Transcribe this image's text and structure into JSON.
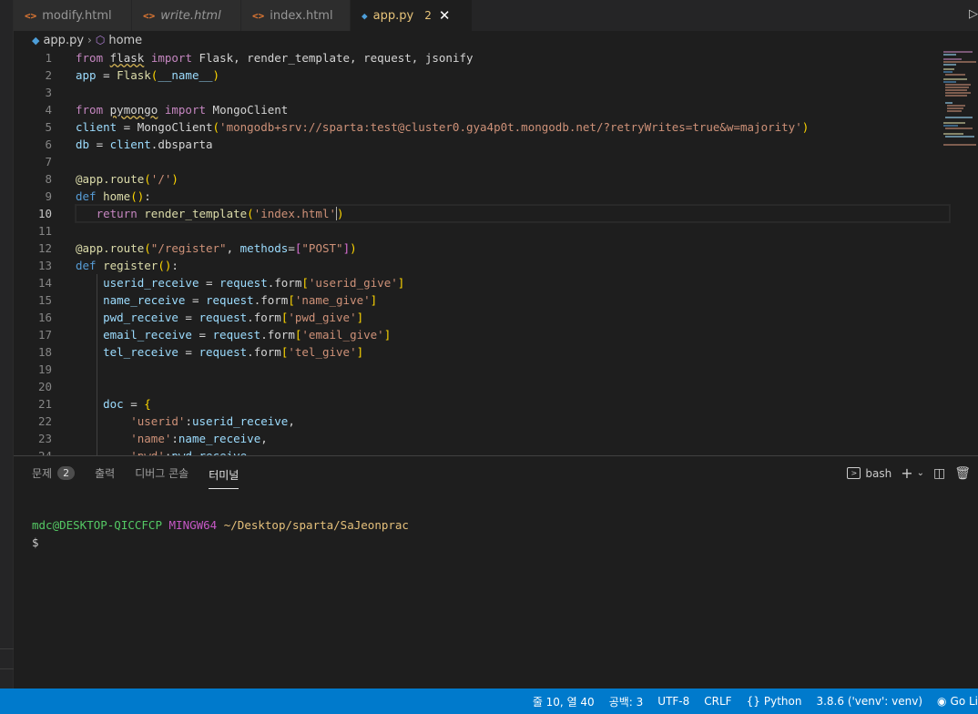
{
  "tabs": [
    {
      "name": "modify.html",
      "icon": "<>",
      "type": "html",
      "italic": false
    },
    {
      "name": "write.html",
      "icon": "<>",
      "type": "html",
      "italic": true
    },
    {
      "name": "index.html",
      "icon": "<>",
      "type": "html",
      "italic": false
    },
    {
      "name": "app.py",
      "icon": "python-icon",
      "type": "py",
      "active": true,
      "problems": "2",
      "close": "✕"
    }
  ],
  "breadcrumb": {
    "file": "app.py",
    "symbol": "home"
  },
  "editor": {
    "current_line": 10,
    "line_numbers": [
      "1",
      "2",
      "3",
      "4",
      "5",
      "6",
      "7",
      "8",
      "9",
      "10",
      "11",
      "12",
      "13",
      "14",
      "15",
      "16",
      "17",
      "18",
      "19",
      "20",
      "21",
      "22",
      "23",
      "24"
    ]
  },
  "panel": {
    "tabs": [
      {
        "label": "문제",
        "badge": "2"
      },
      {
        "label": "출력"
      },
      {
        "label": "디버그 콘솔"
      },
      {
        "label": "터미널",
        "active": true
      }
    ],
    "shell": "bash",
    "terminal": {
      "user": "mdc@DESKTOP-QICCFCP",
      "system": "MINGW64",
      "path": "~/Desktop/sparta/SaJeonprac",
      "prompt": "$"
    }
  },
  "statusbar": {
    "position": "줄 10, 열 40",
    "spaces": "공백: 3",
    "encoding": "UTF-8",
    "eol": "CRLF",
    "language": "Python",
    "interpreter": "3.8.6 ('venv': venv)",
    "golive": "Go Li"
  },
  "colors": {
    "statusbar": "#007acc",
    "editor_bg": "#1e1e1e",
    "active_tab_text": "#e8c47a"
  }
}
